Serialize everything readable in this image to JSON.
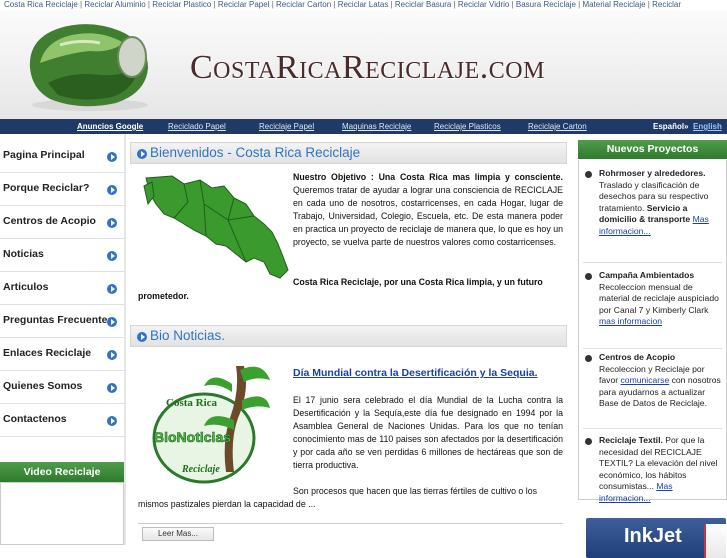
{
  "topbar": {
    "links": [
      "Costa Rica Reciclaje",
      "Reciclar Aluminio",
      "Reciclar Plastico",
      "Reciclar Papel",
      "Reciclar Carton",
      "Reciclar Latas",
      "Reciclar Basura",
      "Reciclar Vidrio",
      "Basura Reciclaje",
      "Material Reciclaje",
      "Reciclar"
    ],
    "separator": " | "
  },
  "header": {
    "site_title": "CostaRicaReciclaje.com"
  },
  "navbar": {
    "google_ads": "Anuncios Google",
    "links": [
      "Reciclado Papel",
      "Reciclaje Papel",
      "Maquinas Reciclaje",
      "Reciclaje Plasticos",
      "Reciclaje Carton"
    ],
    "lang_es": "Español",
    "lang_sep": "»",
    "lang_en": "English"
  },
  "left_nav": {
    "items": [
      "Pagina Principal",
      "Porque Reciclar?",
      "Centros de Acopio",
      "Noticias",
      "Articulos",
      "Preguntas Frecuentes",
      "Enlaces Reciclaje",
      "Quienes Somos",
      "Contactenos"
    ],
    "video_title": "Video Reciclaje"
  },
  "main": {
    "welcome": {
      "heading": "Bienvenidos - Costa Rica Reciclaje",
      "lead": "Nuestro Objetivo : Una Costa Rica mas limpia y consciente.",
      "body": "Queremos tratar de ayudar a lograr una consciencia de RECICLAJE en cada uno de nosotros, costarricenses, en cada Hogar, lugar de Trabajo, Universidad, Colegio, Escuela, etc. De esta manera poder en practica un proyecto de reciclaje de manera que, lo que es hoy un proyecto, se vuelva parte de nuestros valores como costarricenses.",
      "closing_1": "Costa Rica Reciclaje, por una Costa Rica limpia, y un futuro",
      "closing_2": "prometedor."
    },
    "news": {
      "heading": "Bio Noticias.",
      "logo_text_top": "Costa Rica",
      "logo_text_mid": "BioNoticias",
      "logo_text_bottom": "Reciclaje",
      "title": "Día Mundial contra la Desertificación y la Sequia.",
      "body": "El 17 junio sera celebrado el día Mundial de la Lucha contra la Desertificación y la Sequía,este día fue designado en 1994 por la Asamblea General de Naciones Unidas. Para los que no tenían conocimiento mas de 110 paises son afectados por la desertificación y por cada año se ven perdidas 6 millones de hectáreas que son de tierra productiva.",
      "cont_1": "Son procesos que hacen que las tierras fértiles de cultivo o los",
      "cont_2": "mismos pastizales pierdan la capacidad de ...",
      "read_more": "Leer Mas..."
    }
  },
  "right": {
    "title": "Nuevos Proyectos",
    "projects": [
      {
        "title": "Rohrmoser y alrededores.",
        "text": "Traslado y clasificación de desechos para su respectivo tratamiento.",
        "bold_text": "Servicio a domicilio & transporte",
        "more": "Mas informacion..."
      },
      {
        "title": "Campaña Ambientados",
        "text": "Recoleccion mensual de material de reciclaje auspiciado por Canal 7 y Kimberly Clark",
        "more": "mas informacion"
      },
      {
        "title": "Centros de Acopio",
        "text": "Recoleccion y Reciclaje por favor",
        "link": "comunicarse",
        "text2": "con nosotros para ayudarnos a actualizar Base de Datos de Reciclaje."
      },
      {
        "title": "Reciclaje Textil.",
        "text": "Por que la necesidad del RECICLAJE TEXTIL? La elevación del nivel económico, los hábitos consumistas...",
        "more": "Mas informacion..."
      }
    ],
    "ad_text": "InkJet"
  },
  "colors": {
    "nav_bg": "#1f3a66",
    "green_header": "#3f8c3c",
    "link_blue": "#2f73c7"
  }
}
